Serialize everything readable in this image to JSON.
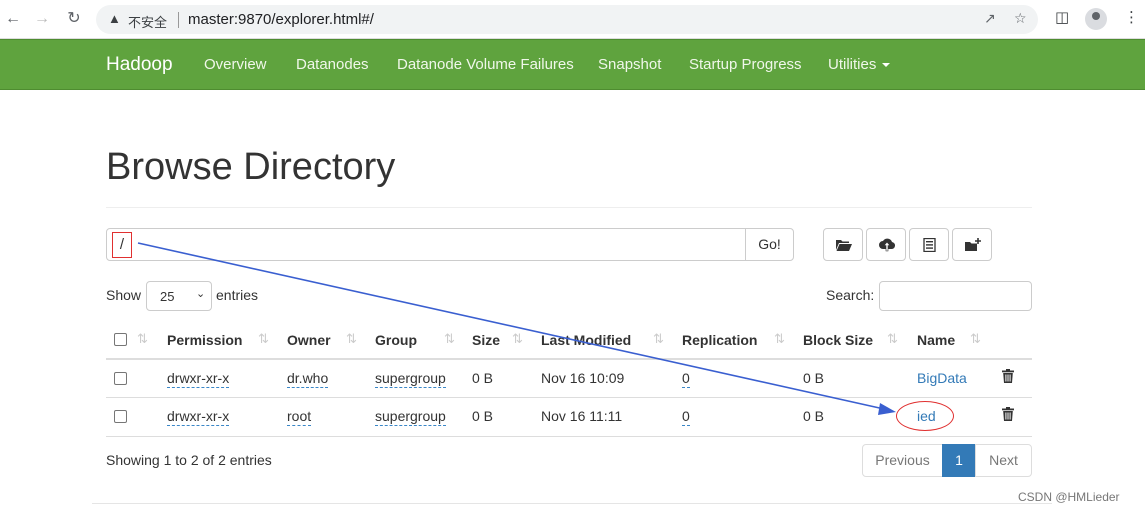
{
  "browser": {
    "insecure_label": "不安全",
    "url": "master:9870/explorer.html#/"
  },
  "navbar": {
    "brand": "Hadoop",
    "links": [
      "Overview",
      "Datanodes",
      "Datanode Volume Failures",
      "Snapshot",
      "Startup Progress",
      "Utilities"
    ]
  },
  "page": {
    "title": "Browse Directory",
    "path_value": "/",
    "go_label": "Go!"
  },
  "toolbar_icons": [
    "folder-open-icon",
    "cloud-upload-icon",
    "list-alt-icon",
    "folder-add-icon"
  ],
  "table_controls": {
    "show_label": "Show",
    "entries_value": "25",
    "entries_label": "entries",
    "search_label": "Search:"
  },
  "table": {
    "columns": [
      "Permission",
      "Owner",
      "Group",
      "Size",
      "Last Modified",
      "Replication",
      "Block Size",
      "Name"
    ],
    "rows": [
      {
        "permission": "drwxr-xr-x",
        "owner": "dr.who",
        "group": "supergroup",
        "size": "0 B",
        "modified": "Nov 16 10:09",
        "replication": "0",
        "block_size": "0 B",
        "name": "BigData"
      },
      {
        "permission": "drwxr-xr-x",
        "owner": "root",
        "group": "supergroup",
        "size": "0 B",
        "modified": "Nov 16 11:11",
        "replication": "0",
        "block_size": "0 B",
        "name": "ied"
      }
    ]
  },
  "footer": {
    "showing_text": "Showing 1 to 2 of 2 entries",
    "prev_label": "Previous",
    "page_label": "1",
    "next_label": "Next"
  },
  "watermark": "CSDN @HMLieder",
  "colors": {
    "navbar": "#5fa33e",
    "link": "#337ab7",
    "annotation": "#e03030",
    "arrow": "#3a5fd0"
  }
}
